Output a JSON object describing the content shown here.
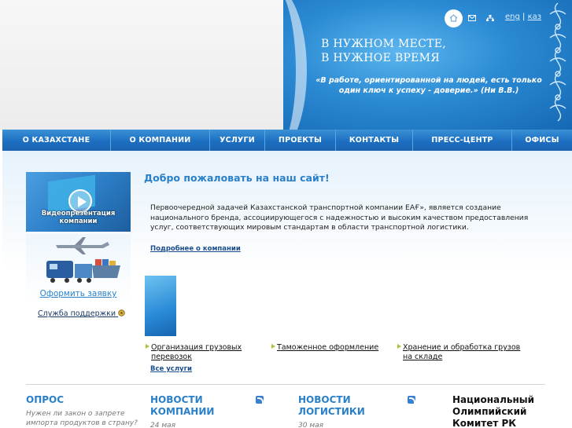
{
  "header": {
    "slogan_line1": "В НУЖНОМ МЕСТЕ,",
    "slogan_line2": "В НУЖНОЕ ВРЕМЯ",
    "quote": "«В работе, ориентированной на людей, есть только один ключ к успеху - доверие.» (Ни В.В.)",
    "lang_eng": "eng",
    "lang_sep": "|",
    "lang_kaz": "каз",
    "icons": [
      "home-icon",
      "mail-icon",
      "sitemap-icon"
    ],
    "banner_color": "#2b8ad3"
  },
  "nav": {
    "items": [
      {
        "label": "О КАЗАХСТАНЕ"
      },
      {
        "label": "О КОМПАНИИ"
      },
      {
        "label": "УСЛУГИ"
      },
      {
        "label": "ПРОЕКТЫ"
      },
      {
        "label": "КОНТАКТЫ"
      },
      {
        "label": "ПРЕСС-ЦЕНТР"
      },
      {
        "label": "ОФИСЫ"
      }
    ]
  },
  "sidebar": {
    "video_caption": "Видеопрезентация компании",
    "order_link": "Оформить заявку",
    "support_link": "Служба поддержки"
  },
  "main": {
    "welcome": "Добро пожаловать на наш сайт!",
    "intro": "Первоочередной задачей Казахстанской транспортной компании   ЕАҒ», является создание национального бренда, ассоциирующегося с надежностью и высоким качеством предоставления услуг, соответствующих мировым стандартам в области транспортной логистики.",
    "more_link": "Подробнее о компании",
    "services": [
      {
        "label": "Организация грузовых перевозок"
      },
      {
        "label": "Таможенное оформление"
      },
      {
        "label": "Хранение и обработка грузов на складе"
      }
    ],
    "all_services": "Все услуги"
  },
  "bottom": {
    "poll_title": "ОПРОС",
    "poll_question": "Нужен ли закон о запрете импорта продуктов в страну?",
    "company_news_title": "НОВОСТИ КОМПАНИИ",
    "company_news_date": "24 мая",
    "logistics_news_title": "НОВОСТИ ЛОГИСТИКИ",
    "logistics_news_date": "30 мая",
    "olympic": "Национальный Олимпийский Комитет РК"
  }
}
